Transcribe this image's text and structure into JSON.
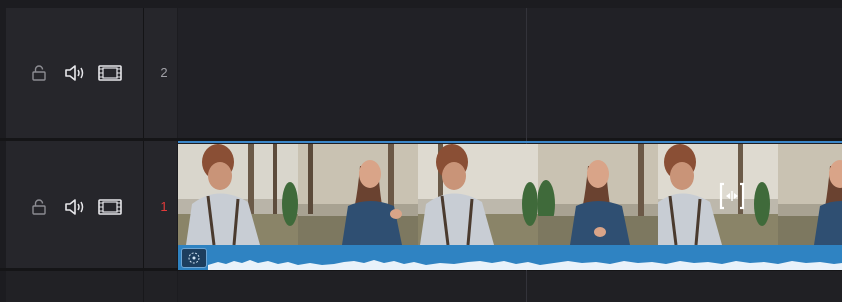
{
  "tracks": [
    {
      "id": "V2",
      "number": "2",
      "active": false
    },
    {
      "id": "V1",
      "number": "1",
      "active": true
    }
  ],
  "icons": {
    "lock": "lock-icon",
    "audio": "speaker-icon",
    "video": "film-icon"
  },
  "colors": {
    "accent": "#3b86c8",
    "audio_waveform_bg": "#2f83c2",
    "active_track_number": "#e23a3a"
  }
}
